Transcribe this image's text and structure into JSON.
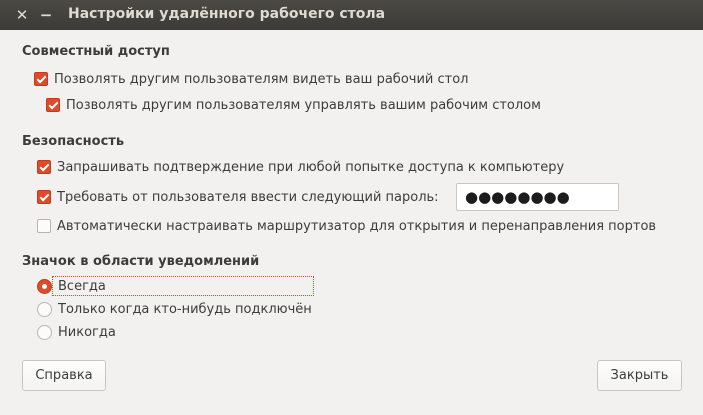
{
  "window": {
    "title": "Настройки удалённого рабочего стола",
    "close_glyph": "✕",
    "minimize_glyph": "−"
  },
  "sharing": {
    "title": "Совместный доступ",
    "allow_view": {
      "label": "Позволять другим пользователям видеть ваш рабочий стол",
      "checked": true
    },
    "allow_control": {
      "label": "Позволять другим пользователям управлять вашим рабочим столом",
      "checked": true
    }
  },
  "security": {
    "title": "Безопасность",
    "confirm_access": {
      "label": "Запрашивать подтверждение при любой попытке доступа к компьютеру",
      "checked": true
    },
    "require_password": {
      "label": "Требовать от пользователя ввести следующий пароль:",
      "checked": true
    },
    "password_value": "●●●●●●●●",
    "auto_router": {
      "label": "Автоматически настраивать маршрутизатор для открытия и перенаправления портов",
      "checked": false
    }
  },
  "notification_icon": {
    "title": "Значок в области уведомлений",
    "options": [
      {
        "label": "Всегда",
        "selected": true
      },
      {
        "label": "Только когда кто-нибудь подключён",
        "selected": false
      },
      {
        "label": "Никогда",
        "selected": false
      }
    ]
  },
  "buttons": {
    "help": "Справка",
    "close": "Закрыть"
  },
  "colors": {
    "accent": "#df4a2a",
    "titlebar": "#3c3b37",
    "background": "#f2f1f0"
  }
}
